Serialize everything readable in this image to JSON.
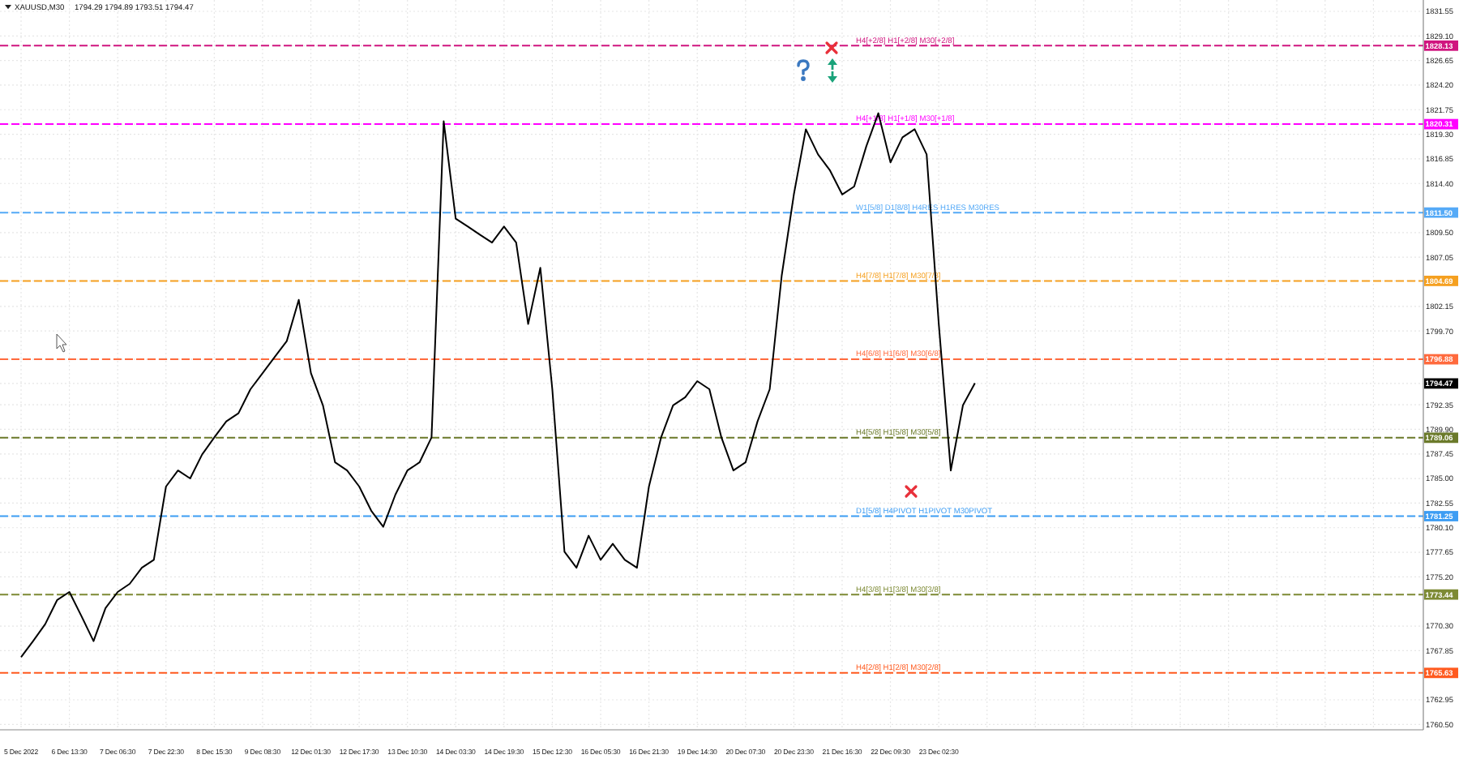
{
  "header": {
    "quotes": "1794.29 1794.89 1793.51 1794.47"
  },
  "chart": {
    "chart_data": {
      "type": "line",
      "grid": true,
      "ylim": [
        1759.96,
        1832.68
      ],
      "categories": [
        "5 Dec 2022",
        null,
        null,
        null,
        "6 Dec 13:30",
        null,
        null,
        null,
        "7 Dec 06:30",
        null,
        null,
        null,
        "7 Dec 22:30",
        null,
        null,
        null,
        "8 Dec 15:30",
        null,
        null,
        null,
        "9 Dec 08:30",
        null,
        null,
        null,
        "12 Dec 01:30",
        null,
        null,
        null,
        "12 Dec 17:30",
        null,
        null,
        null,
        "13 Dec 10:30",
        null,
        null,
        null,
        "14 Dec 03:30",
        null,
        null,
        null,
        "14 Dec 19:30",
        null,
        null,
        null,
        "15 Dec 12:30",
        null,
        null,
        null,
        "16 Dec 05:30",
        null,
        null,
        null,
        "16 Dec 21:30",
        null,
        null,
        null,
        "19 Dec 14:30",
        null,
        null,
        null,
        "20 Dec 07:30",
        null,
        null,
        null,
        "20 Dec 23:30",
        null,
        null,
        null,
        "21 Dec 16:30",
        null,
        null,
        null,
        "22 Dec 09:30",
        null,
        null,
        null,
        "23 Dec 02:30",
        null,
        null,
        null,
        null,
        null,
        null,
        null,
        null,
        null,
        null,
        null,
        null,
        null,
        null,
        null,
        null,
        null,
        null,
        null,
        null,
        null,
        null,
        null,
        null,
        null,
        null,
        null,
        null,
        null,
        null,
        null,
        null,
        null,
        null,
        null,
        null,
        null,
        null,
        null
      ],
      "yticks": [
        {
          "value": 1831.55,
          "label": "1831.55"
        },
        {
          "value": 1829.1,
          "label": "1829.10"
        },
        {
          "value": 1828.13,
          "label": "1828.13"
        },
        {
          "value": 1826.65,
          "label": "1826.65"
        },
        {
          "value": 1824.2,
          "label": "1824.20"
        },
        {
          "value": 1821.75,
          "label": "1821.75"
        },
        {
          "value": 1820.31,
          "label": "1820.31"
        },
        {
          "value": 1819.3,
          "label": "1819.30"
        },
        {
          "value": 1816.85,
          "label": "1816.85"
        },
        {
          "value": 1814.4,
          "label": "1814.40"
        },
        {
          "value": 1811.5,
          "label": "1811.50"
        },
        {
          "value": 1809.5,
          "label": "1809.50"
        },
        {
          "value": 1807.05,
          "label": "1807.05"
        },
        {
          "value": 1804.69,
          "label": "1804.69"
        },
        {
          "value": 1802.15,
          "label": "1802.15"
        },
        {
          "value": 1799.7,
          "label": "1799.70"
        },
        {
          "value": 1796.88,
          "label": "1796.88"
        },
        {
          "value": 1794.47,
          "label": "1794.47"
        },
        {
          "value": 1792.35,
          "label": "1792.35"
        },
        {
          "value": 1789.9,
          "label": "1789.90"
        },
        {
          "value": 1789.06,
          "label": "1789.06"
        },
        {
          "value": 1787.45,
          "label": "1787.45"
        },
        {
          "value": 1785.0,
          "label": "1785.00"
        },
        {
          "value": 1782.55,
          "label": "1782.55"
        },
        {
          "value": 1781.25,
          "label": "1781.25"
        },
        {
          "value": 1780.1,
          "label": "1780.10"
        },
        {
          "value": 1777.65,
          "label": "1777.65"
        },
        {
          "value": 1775.2,
          "label": "1775.20"
        },
        {
          "value": 1773.44,
          "label": "1773.44"
        },
        {
          "value": 1770.3,
          "label": "1770.30"
        },
        {
          "value": 1767.85,
          "label": "1767.85"
        },
        {
          "value": 1765.63,
          "label": "1765.63"
        },
        {
          "value": 1762.95,
          "label": "1762.95"
        },
        {
          "value": 1760.5,
          "label": "1760.50"
        }
      ],
      "series": [
        {
          "name": "XAUUSD,M30",
          "color": "#000000",
          "values": [
            1767.2,
            1768.8,
            1770.5,
            1772.9,
            1773.7,
            1771.3,
            1768.8,
            1772.1,
            1773.7,
            1774.5,
            1776.1,
            1776.9,
            1784.2,
            1785.8,
            1785.0,
            1787.4,
            1789.1,
            1790.7,
            1791.5,
            1793.9,
            1795.5,
            1797.1,
            1798.7,
            1802.8,
            1795.5,
            1792.3,
            1786.6,
            1785.8,
            1784.2,
            1781.8,
            1780.2,
            1783.4,
            1785.8,
            1786.6,
            1789.1,
            1820.6,
            1810.9,
            1810.1,
            1809.3,
            1808.5,
            1810.1,
            1808.5,
            1800.4,
            1806.0,
            1793.9,
            1777.7,
            1776.1,
            1779.3,
            1776.9,
            1778.5,
            1776.9,
            1776.1,
            1784.2,
            1789.1,
            1792.3,
            1793.1,
            1794.7,
            1793.9,
            1789.1,
            1785.8,
            1786.6,
            1790.7,
            1793.9,
            1805.2,
            1813.3,
            1819.8,
            1817.3,
            1815.7,
            1813.3,
            1814.1,
            1818.1,
            1821.4,
            1816.5,
            1819.0,
            1819.8,
            1817.3,
            1800.4,
            1785.8,
            1792.3,
            1794.5,
            null,
            null,
            null,
            null,
            null,
            null,
            null,
            null,
            null,
            null,
            null,
            null,
            null,
            null,
            null,
            null,
            null,
            null,
            null,
            null,
            null,
            null,
            null,
            null,
            null,
            null,
            null,
            null,
            null,
            null,
            null,
            null,
            null,
            null,
            null,
            null
          ]
        }
      ],
      "ref_lines": [
        {
          "axis": "y",
          "value": 1828.13,
          "label": "H4[+2/8] H1[+2/8] M30[+2/8]",
          "color": "#d0157f"
        },
        {
          "axis": "y",
          "value": 1820.31,
          "label": "H4[+1/8] H1[+1/8] M30[+1/8]",
          "color": "#ff00ff"
        },
        {
          "axis": "y",
          "value": 1811.5,
          "label": "W1[5/8] D1[8/8] H4RES H1RES M30RES",
          "color": "#55aaf7"
        },
        {
          "axis": "y",
          "value": 1804.69,
          "label": "H4[7/8] H1[7/8] M30[7/8]",
          "color": "#f5a020"
        },
        {
          "axis": "y",
          "value": 1796.88,
          "label": "H4[6/8] H1[6/8] M30[6/8]",
          "color": "#ff6a3d"
        },
        {
          "axis": "y",
          "value": 1789.06,
          "label": "H4[5/8] H1[5/8] M30[5/8]",
          "color": "#6b7a2a"
        },
        {
          "axis": "y",
          "value": 1781.25,
          "label": "D1[5/8] H4PIVOT H1PIVOT M30PIVOT",
          "color": "#3d9df3"
        },
        {
          "axis": "y",
          "value": 1773.44,
          "label": "H4[3/8] H1[3/8] M30[3/8]",
          "color": "#7d8a34"
        },
        {
          "axis": "y",
          "value": 1765.63,
          "label": "H4[2/8] H1[2/8] M30[2/8]",
          "color": "#ff5a1f"
        }
      ]
    }
  }
}
